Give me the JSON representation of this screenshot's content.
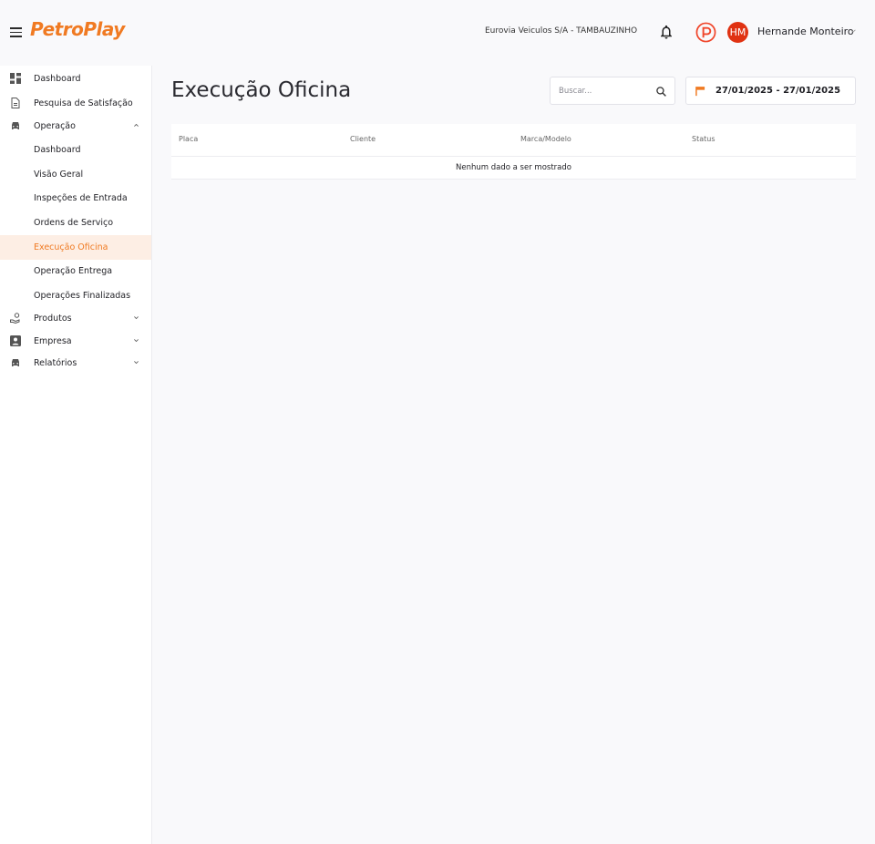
{
  "header": {
    "logo": "PetroPlay",
    "company": "Eurovia Veiculos S/A - TAMBAUZINHO",
    "avatar_initials": "HM",
    "user_name": "Hernande Monteiro",
    "avatar_color": "#e03212",
    "accent_color": "#f07a22"
  },
  "sidebar": {
    "items": [
      {
        "label": "Dashboard",
        "icon": "dashboard-icon"
      },
      {
        "label": "Pesquisa de Satisfação",
        "icon": "document-icon"
      },
      {
        "label": "Operação",
        "icon": "car-icon",
        "expanded": true
      },
      {
        "label": "Dashboard"
      },
      {
        "label": "Visão Geral"
      },
      {
        "label": "Inspeções de Entrada"
      },
      {
        "label": "Ordens de Serviço"
      },
      {
        "label": "Execução Oficina",
        "active": true
      },
      {
        "label": "Operação Entrega"
      },
      {
        "label": "Operações Finalizadas"
      },
      {
        "label": "Produtos",
        "icon": "hand-coin-icon"
      },
      {
        "label": "Empresa",
        "icon": "contact-icon"
      },
      {
        "label": "Relatórios",
        "icon": "car-icon"
      }
    ]
  },
  "main": {
    "title": "Execução Oficina",
    "search_placeholder": "Buscar...",
    "date_range": "27/01/2025 - 27/01/2025",
    "table": {
      "columns": [
        "Placa",
        "Cliente",
        "Marca/Modelo",
        "Status"
      ],
      "empty_message": "Nenhum dado a ser mostrado"
    }
  }
}
